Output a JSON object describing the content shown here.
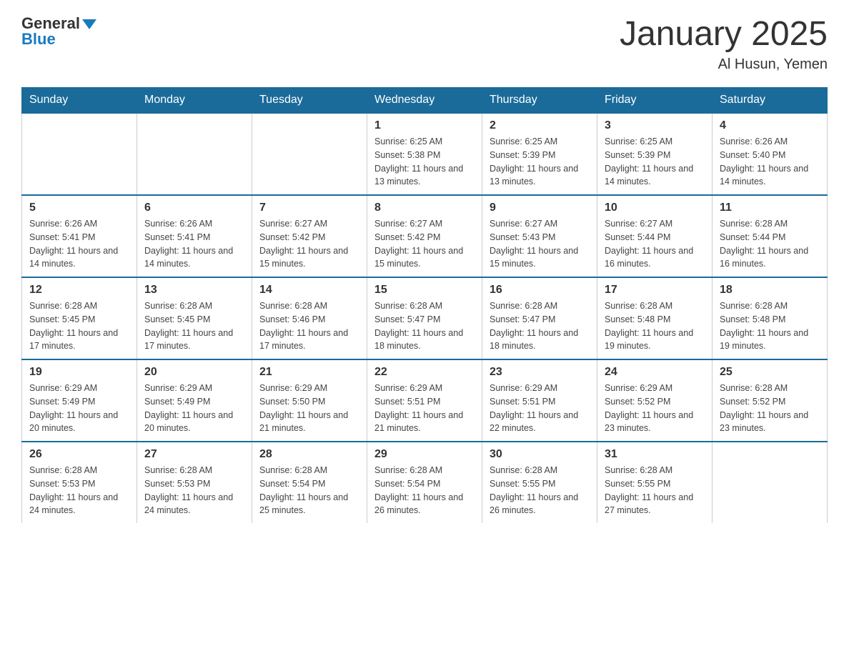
{
  "header": {
    "logo_general": "General",
    "logo_blue": "Blue",
    "title": "January 2025",
    "subtitle": "Al Husun, Yemen"
  },
  "days_of_week": [
    "Sunday",
    "Monday",
    "Tuesday",
    "Wednesday",
    "Thursday",
    "Friday",
    "Saturday"
  ],
  "weeks": [
    [
      {
        "day": "",
        "info": ""
      },
      {
        "day": "",
        "info": ""
      },
      {
        "day": "",
        "info": ""
      },
      {
        "day": "1",
        "info": "Sunrise: 6:25 AM\nSunset: 5:38 PM\nDaylight: 11 hours and 13 minutes."
      },
      {
        "day": "2",
        "info": "Sunrise: 6:25 AM\nSunset: 5:39 PM\nDaylight: 11 hours and 13 minutes."
      },
      {
        "day": "3",
        "info": "Sunrise: 6:25 AM\nSunset: 5:39 PM\nDaylight: 11 hours and 14 minutes."
      },
      {
        "day": "4",
        "info": "Sunrise: 6:26 AM\nSunset: 5:40 PM\nDaylight: 11 hours and 14 minutes."
      }
    ],
    [
      {
        "day": "5",
        "info": "Sunrise: 6:26 AM\nSunset: 5:41 PM\nDaylight: 11 hours and 14 minutes."
      },
      {
        "day": "6",
        "info": "Sunrise: 6:26 AM\nSunset: 5:41 PM\nDaylight: 11 hours and 14 minutes."
      },
      {
        "day": "7",
        "info": "Sunrise: 6:27 AM\nSunset: 5:42 PM\nDaylight: 11 hours and 15 minutes."
      },
      {
        "day": "8",
        "info": "Sunrise: 6:27 AM\nSunset: 5:42 PM\nDaylight: 11 hours and 15 minutes."
      },
      {
        "day": "9",
        "info": "Sunrise: 6:27 AM\nSunset: 5:43 PM\nDaylight: 11 hours and 15 minutes."
      },
      {
        "day": "10",
        "info": "Sunrise: 6:27 AM\nSunset: 5:44 PM\nDaylight: 11 hours and 16 minutes."
      },
      {
        "day": "11",
        "info": "Sunrise: 6:28 AM\nSunset: 5:44 PM\nDaylight: 11 hours and 16 minutes."
      }
    ],
    [
      {
        "day": "12",
        "info": "Sunrise: 6:28 AM\nSunset: 5:45 PM\nDaylight: 11 hours and 17 minutes."
      },
      {
        "day": "13",
        "info": "Sunrise: 6:28 AM\nSunset: 5:45 PM\nDaylight: 11 hours and 17 minutes."
      },
      {
        "day": "14",
        "info": "Sunrise: 6:28 AM\nSunset: 5:46 PM\nDaylight: 11 hours and 17 minutes."
      },
      {
        "day": "15",
        "info": "Sunrise: 6:28 AM\nSunset: 5:47 PM\nDaylight: 11 hours and 18 minutes."
      },
      {
        "day": "16",
        "info": "Sunrise: 6:28 AM\nSunset: 5:47 PM\nDaylight: 11 hours and 18 minutes."
      },
      {
        "day": "17",
        "info": "Sunrise: 6:28 AM\nSunset: 5:48 PM\nDaylight: 11 hours and 19 minutes."
      },
      {
        "day": "18",
        "info": "Sunrise: 6:28 AM\nSunset: 5:48 PM\nDaylight: 11 hours and 19 minutes."
      }
    ],
    [
      {
        "day": "19",
        "info": "Sunrise: 6:29 AM\nSunset: 5:49 PM\nDaylight: 11 hours and 20 minutes."
      },
      {
        "day": "20",
        "info": "Sunrise: 6:29 AM\nSunset: 5:49 PM\nDaylight: 11 hours and 20 minutes."
      },
      {
        "day": "21",
        "info": "Sunrise: 6:29 AM\nSunset: 5:50 PM\nDaylight: 11 hours and 21 minutes."
      },
      {
        "day": "22",
        "info": "Sunrise: 6:29 AM\nSunset: 5:51 PM\nDaylight: 11 hours and 21 minutes."
      },
      {
        "day": "23",
        "info": "Sunrise: 6:29 AM\nSunset: 5:51 PM\nDaylight: 11 hours and 22 minutes."
      },
      {
        "day": "24",
        "info": "Sunrise: 6:29 AM\nSunset: 5:52 PM\nDaylight: 11 hours and 23 minutes."
      },
      {
        "day": "25",
        "info": "Sunrise: 6:28 AM\nSunset: 5:52 PM\nDaylight: 11 hours and 23 minutes."
      }
    ],
    [
      {
        "day": "26",
        "info": "Sunrise: 6:28 AM\nSunset: 5:53 PM\nDaylight: 11 hours and 24 minutes."
      },
      {
        "day": "27",
        "info": "Sunrise: 6:28 AM\nSunset: 5:53 PM\nDaylight: 11 hours and 24 minutes."
      },
      {
        "day": "28",
        "info": "Sunrise: 6:28 AM\nSunset: 5:54 PM\nDaylight: 11 hours and 25 minutes."
      },
      {
        "day": "29",
        "info": "Sunrise: 6:28 AM\nSunset: 5:54 PM\nDaylight: 11 hours and 26 minutes."
      },
      {
        "day": "30",
        "info": "Sunrise: 6:28 AM\nSunset: 5:55 PM\nDaylight: 11 hours and 26 minutes."
      },
      {
        "day": "31",
        "info": "Sunrise: 6:28 AM\nSunset: 5:55 PM\nDaylight: 11 hours and 27 minutes."
      },
      {
        "day": "",
        "info": ""
      }
    ]
  ]
}
